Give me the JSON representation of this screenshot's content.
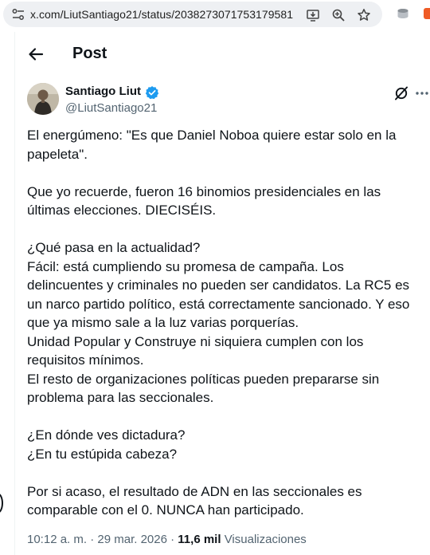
{
  "browser": {
    "url_domain": "x.com",
    "url_path": "/LiutSantiago21/status/2038273071753179581"
  },
  "header": {
    "title": "Post"
  },
  "author": {
    "name": "Santiago Liut",
    "handle": "@LiutSantiago21",
    "verified": true
  },
  "tweet": {
    "lines": [
      "El energúmeno: \"Es que Daniel Noboa quiere estar solo en la",
      "papeleta\".",
      "",
      "Que yo recuerde, fueron 16 binomios presidenciales en las",
      "últimas elecciones. DIECISÉIS.",
      "",
      "¿Qué pasa en la actualidad?",
      "Fácil: está cumpliendo su promesa de campaña. Los",
      "delincuentes y criminales no pueden ser candidatos. La RC5 es",
      "un narco partido político, está correctamente sancionado. Y eso",
      "que ya mismo sale a la luz varias porquerías.",
      "Unidad Popular y Construye ni siquiera cumplen con los",
      "requisitos mínimos.",
      "El resto de organizaciones políticas pueden prepararse sin",
      "problema para las seccionales.",
      "",
      "¿En dónde ves dictadura?",
      "¿En tu estúpida cabeza?",
      "",
      "Por si acaso, el resultado de ADN en las seccionales es",
      "comparable con el 0. NUNCA han participado."
    ]
  },
  "meta": {
    "time": "10:12 a. m.",
    "separator": "·",
    "date": "29 mar. 2026",
    "views_count": "11,6 mil",
    "views_label": "Visualizaciones"
  },
  "colors": {
    "text_primary": "#0f1419",
    "text_secondary": "#536471",
    "verified_blue": "#1d9bf0",
    "urlbar_bg": "#eef0f3"
  },
  "icons": {
    "site_info": "tune-icon",
    "install": "install-app-icon",
    "zoom": "zoom-icon",
    "bookmark": "star-icon",
    "extension": "extension-icon",
    "back": "arrow-left-icon",
    "verified": "verified-badge-icon",
    "grok": "grok-icon",
    "more": "more-horizontal-icon"
  }
}
